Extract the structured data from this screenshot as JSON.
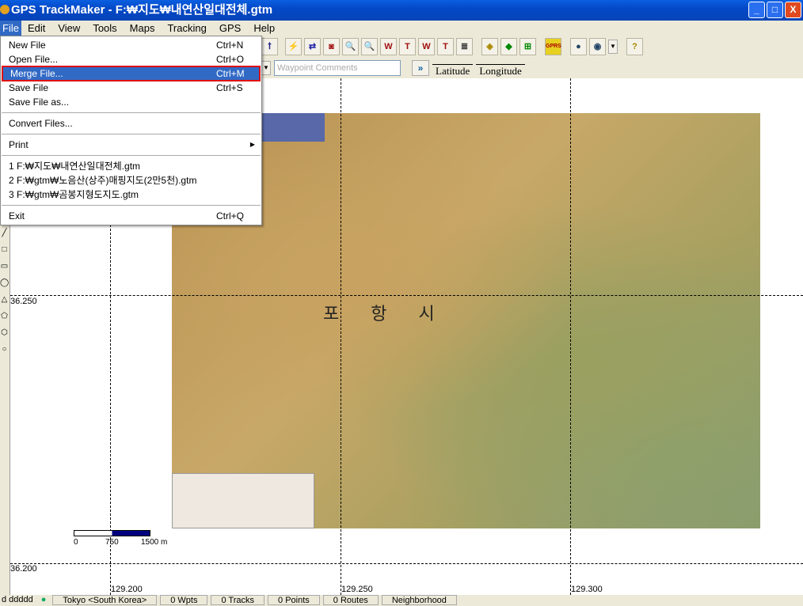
{
  "window": {
    "title": "GPS TrackMaker - F:₩지도₩내연산일대전체.gtm",
    "minimize": "_",
    "maximize": "□",
    "close": "X"
  },
  "menubar": [
    "File",
    "Edit",
    "View",
    "Tools",
    "Maps",
    "Tracking",
    "GPS",
    "Help"
  ],
  "file_menu": {
    "items": [
      {
        "label": "New File",
        "shortcut": "Ctrl+N"
      },
      {
        "label": "Open File...",
        "shortcut": "Ctrl+O"
      },
      {
        "label": "Merge File...",
        "shortcut": "Ctrl+M"
      },
      {
        "label": "Save File",
        "shortcut": "Ctrl+S"
      },
      {
        "label": "Save File as...",
        "shortcut": ""
      },
      {
        "label": "Convert Files...",
        "shortcut": ""
      },
      {
        "label": "Print",
        "shortcut": ""
      },
      {
        "label": "1 F:₩지도₩내연산일대전체.gtm",
        "shortcut": ""
      },
      {
        "label": "2 F:₩gtm₩노음산(상주)매핑지도(2만5천).gtm",
        "shortcut": ""
      },
      {
        "label": "3 F:₩gtm₩곰봉지형도지도.gtm",
        "shortcut": ""
      },
      {
        "label": "Exit",
        "shortcut": "Ctrl+Q"
      }
    ],
    "highlighted": "Merge File..."
  },
  "toolbar": {
    "gprs": "GPRS",
    "help": "?",
    "w": "W",
    "t": "T"
  },
  "row2": {
    "waypoint_placeholder": "Waypoint Comments",
    "go": "»",
    "latitude": "Latitude",
    "longitude": "Longitude"
  },
  "grid": {
    "lat": [
      "36.250",
      "36.200"
    ],
    "lon": [
      "129.200",
      "129.250",
      "129.300"
    ]
  },
  "map": {
    "city_label": "포항시"
  },
  "scale": {
    "labels": [
      "0",
      "750",
      "1500 m"
    ]
  },
  "status": {
    "format": "d ddddd",
    "datum": "Tokyo <South Korea>",
    "wpts": "0 Wpts",
    "tracks": "0 Tracks",
    "points": "0 Points",
    "routes": "0 Routes",
    "zoom": "Neighborhood"
  }
}
